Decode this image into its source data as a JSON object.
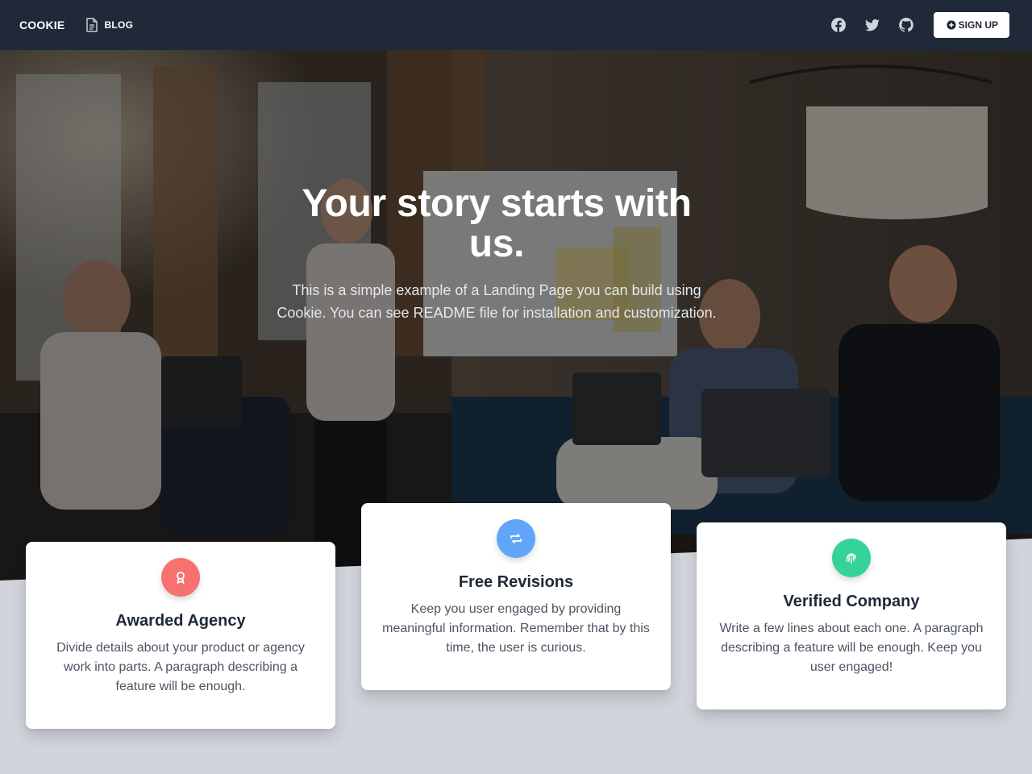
{
  "nav": {
    "brand": "COOKIE",
    "blog_label": "BLOG",
    "signup_label": "SIGN UP",
    "social": [
      "facebook-icon",
      "twitter-icon",
      "github-icon"
    ]
  },
  "hero": {
    "title": "Your story starts with us.",
    "text": "This is a simple example of a Landing Page you can build using Cookie. You can see README file for installation and customization."
  },
  "features": [
    {
      "title": "Awarded Agency",
      "text": "Divide details about your product or agency work into parts. A paragraph describing a feature will be enough.",
      "icon": "award-icon",
      "color": "#f87171"
    },
    {
      "title": "Free Revisions",
      "text": "Keep you user engaged by providing meaningful information. Remember that by this time, the user is curious.",
      "icon": "retweet-icon",
      "color": "#60a5fa"
    },
    {
      "title": "Verified Company",
      "text": "Write a few lines about each one. A paragraph describing a feature will be enough. Keep you user engaged!",
      "icon": "fingerprint-icon",
      "color": "#34d399"
    }
  ],
  "colors": {
    "nav_bg": "#1f2937",
    "section_bg": "#d1d5db"
  }
}
